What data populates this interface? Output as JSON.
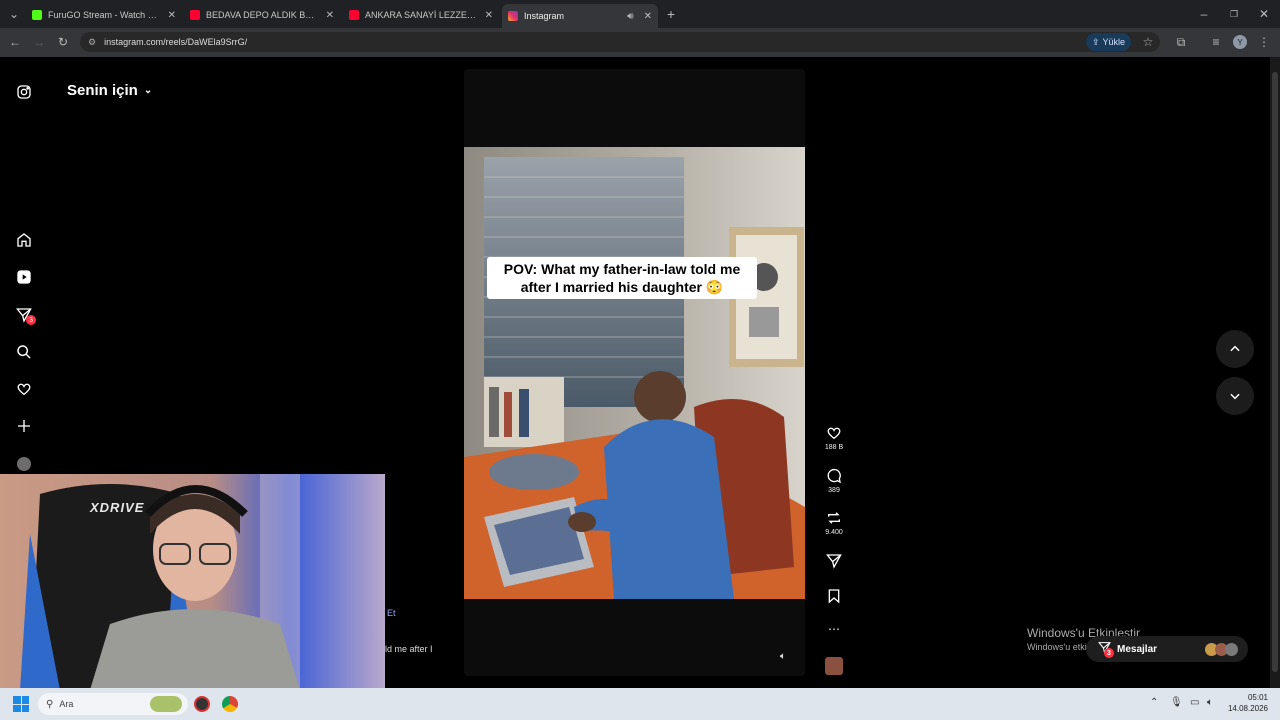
{
  "browser": {
    "tabs": [
      {
        "title": "FuruGO Stream - Watch Live on",
        "color": "#53fc18"
      },
      {
        "title": "BEDAVA DEPO ALDIK BUNLAR",
        "color": "#ff0033"
      },
      {
        "title": "ANKARA SANAYİ LEZZETLERİNİ",
        "color": "#ff0033"
      },
      {
        "title": "Instagram",
        "color": "#e1306c"
      }
    ],
    "url": "instagram.com/reels/DaWEla9SrrG/",
    "upload_label": "Yükle",
    "profile_letter": "Y"
  },
  "instagram": {
    "feed_title": "Senin için",
    "notification_count": "3",
    "video_caption": "POV: What my father-in-law told me after I married his daughter 😳",
    "actions": {
      "likes": "188 B",
      "comments": "389",
      "reposts": "9.400"
    },
    "side_caption_fragment_1": "Et",
    "side_caption_fragment_2": "ld me after I",
    "messages_label": "Mesajlar",
    "messages_badge": "3"
  },
  "webcam": {
    "chair_brand": "XDRIVE"
  },
  "windows": {
    "activate_title": "Windows'u Etkinleştir",
    "activate_subtitle": "Windows'u etkinleştirmek için Ayarlar'a gidin.",
    "search_placeholder": "Ara",
    "time": "05:01",
    "date": "14.08.2026"
  }
}
